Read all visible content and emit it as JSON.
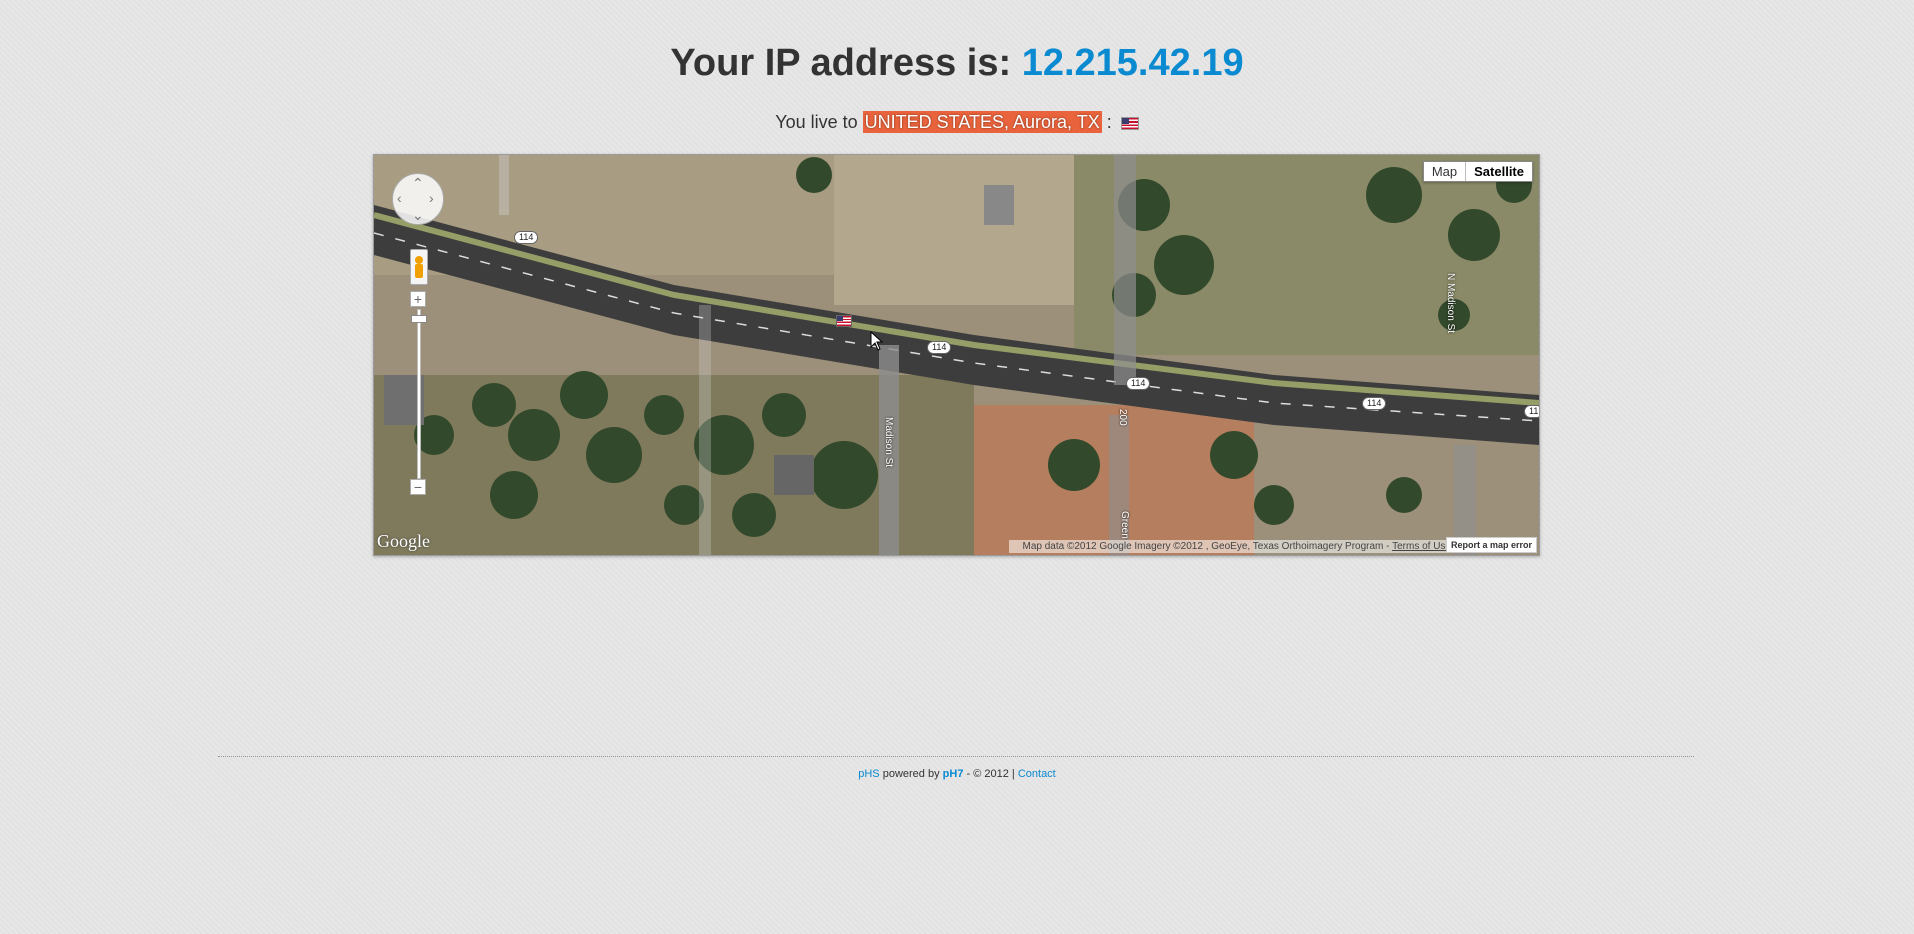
{
  "header": {
    "title_prefix": "Your IP address is:",
    "ip": "12.215.42.19"
  },
  "location": {
    "prefix": "You live to",
    "place": "UNITED STATES, Aurora, TX",
    "separator": ":",
    "flag_icon": "us-flag-icon"
  },
  "map": {
    "type_map_label": "Map",
    "type_satellite_label": "Satellite",
    "selected_type": "Satellite",
    "logo_text": "Google",
    "attribution": "Map data ©2012 Google Imagery ©2012 , GeoEye, Texas Orthoimagery Program -",
    "terms_link": "Terms of Use",
    "report_label": "Report a map error",
    "road_labels": [
      "114",
      "114",
      "114",
      "114",
      "11"
    ],
    "street_labels": [
      "N Madison St",
      "Madison St",
      "200",
      "Green"
    ]
  },
  "footer": {
    "site_link": "pHS",
    "powered_text": "powered by",
    "ph7_link": "pH7",
    "copyright": "- © 2012 |",
    "contact_link": "Contact"
  },
  "colors": {
    "accent": "#0a8ad0",
    "highlight": "#e9633c",
    "text": "#333333",
    "background": "#e6e6e6"
  }
}
